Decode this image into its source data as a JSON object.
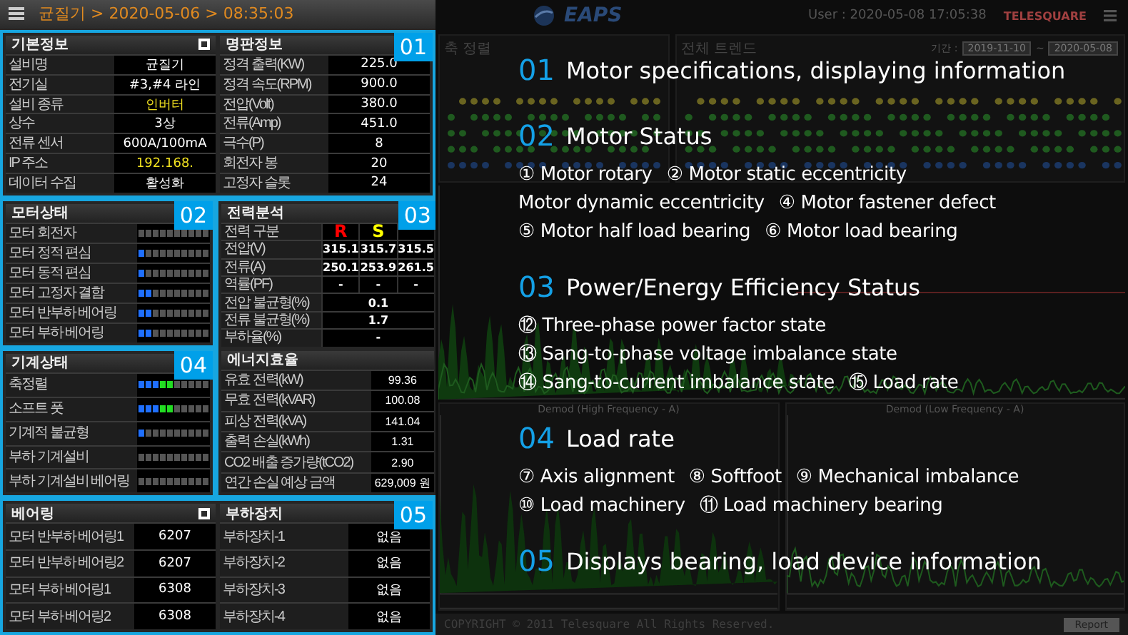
{
  "header": {
    "breadcrumb": "균질기 > 2020-05-06 > 08:35:03"
  },
  "basic_info": {
    "title": "기본정보",
    "badge": "01",
    "rows": [
      {
        "label": "설비명",
        "value": "균질기",
        "highlight": false
      },
      {
        "label": "전기실",
        "value": "#3,#4 라인",
        "highlight": false
      },
      {
        "label": "설비 종류",
        "value": "인버터",
        "highlight": true
      },
      {
        "label": "상수",
        "value": "3상",
        "highlight": false
      },
      {
        "label": "전류 센서",
        "value": "600A/100mA",
        "highlight": false
      },
      {
        "label": "IP 주소",
        "value": "192.168.",
        "highlight": true
      },
      {
        "label": "데이터 수집",
        "value": "활성화",
        "highlight": false
      }
    ]
  },
  "nameplate": {
    "title": "명판정보",
    "rows": [
      {
        "label": "정격 출력(KW)",
        "value": "225.0"
      },
      {
        "label": "정격 속도(RPM)",
        "value": "900.0"
      },
      {
        "label": "전압(Volt)",
        "value": "380.0"
      },
      {
        "label": "전류(Amp)",
        "value": "451.0"
      },
      {
        "label": "극수(P)",
        "value": "8"
      },
      {
        "label": "회전자 봉",
        "value": "20"
      },
      {
        "label": "고정자 슬롯",
        "value": "24"
      }
    ]
  },
  "motor_status": {
    "title": "모터상태",
    "badge": "02",
    "rows": [
      {
        "label": "모터 회전자",
        "level": 0
      },
      {
        "label": "모터 정적 편심",
        "level": 0.1
      },
      {
        "label": "모터 동적 편심",
        "level": 0.1
      },
      {
        "label": "모터 고정자 결함",
        "level": 0.2
      },
      {
        "label": "모터 반부하 베어링",
        "level": 0.2
      },
      {
        "label": "모터 부하 베어링",
        "level": 0.2
      }
    ]
  },
  "power_analysis": {
    "title": "전력분석",
    "badge": "03",
    "phase_label": "전력 구분",
    "phases": [
      {
        "name": "R",
        "color": "#ff0000"
      },
      {
        "name": "S",
        "color": "#ffff00"
      }
    ],
    "rows": [
      {
        "label": "전압(V)",
        "values": [
          "315.1",
          "315.7",
          "315.5"
        ]
      },
      {
        "label": "전류(A)",
        "values": [
          "250.1",
          "253.9",
          "261.5"
        ]
      },
      {
        "label": "역률(PF)",
        "values": [
          "-",
          "-",
          "-"
        ]
      },
      {
        "label": "전압 불균형(%)",
        "values": [
          "0.1"
        ]
      },
      {
        "label": "전류 불균형(%)",
        "values": [
          "1.7"
        ]
      },
      {
        "label": "부하율(%)",
        "values": [
          "-"
        ]
      }
    ]
  },
  "machine_status": {
    "title": "기계상태",
    "badge": "04",
    "rows": [
      {
        "label": "축정렬",
        "level": 0.5
      },
      {
        "label": "소프트 풋",
        "level": 0.5
      },
      {
        "label": "기계적 불균형",
        "level": 0.1
      },
      {
        "label": "부하 기계설비",
        "level": 0
      },
      {
        "label": "부하 기계설비 베어링",
        "level": 0
      }
    ]
  },
  "energy": {
    "title": "에너지효율",
    "rows": [
      {
        "label": "유효 전력(kW)",
        "value": "99.36"
      },
      {
        "label": "무효 전력(kVAR)",
        "value": "100.08"
      },
      {
        "label": "피상 전력(kVA)",
        "value": "141.04"
      },
      {
        "label": "출력 손실(kWh)",
        "value": "1.31"
      },
      {
        "label": "CO2 배출 증가량(tCO2)",
        "value": "2.90"
      },
      {
        "label": "연간 손실 예상 금액",
        "value": "629,009 원"
      }
    ]
  },
  "bearing": {
    "title": "베어링",
    "badge": "05",
    "rows": [
      {
        "label": "모터 반부하 베어링1",
        "value": "6207"
      },
      {
        "label": "모터 반부하 베어링2",
        "value": "6207"
      },
      {
        "label": "모터 부하 베어링1",
        "value": "6308"
      },
      {
        "label": "모터 부하 베어링2",
        "value": "6308"
      }
    ]
  },
  "load_device": {
    "title": "부하장치",
    "rows": [
      {
        "label": "부하장치-1",
        "value": "없음"
      },
      {
        "label": "부하장치-2",
        "value": "없음"
      },
      {
        "label": "부하장치-3",
        "value": "없음"
      },
      {
        "label": "부하장치-4",
        "value": "없음"
      }
    ]
  },
  "dashboard": {
    "logo": "EAPS",
    "user": "User : 2020-05-08 17:05:38",
    "brand": "TELESQUARE",
    "align_title": "축 정렬",
    "trend_title": "전체 트렌드",
    "period_label": "기간 :",
    "period_from": "2019-11-10",
    "period_sep": "~",
    "period_to": "2020-05-08",
    "demod_high": "Demod (High Frequency - A)",
    "demod_low": "Demod (Low Frequency - A)",
    "copyright": "COPYRIGHT © 2011 Telesquare All Rights Reserved.",
    "report": "Report"
  },
  "notes": [
    {
      "number": "01",
      "title": "Motor specifications, displaying information"
    },
    {
      "number": "02",
      "title": "Motor Status",
      "lines": [
        [
          "① Motor rotary",
          "② Motor static eccentricity"
        ],
        [
          "Motor dynamic eccentricity",
          "④ Motor fastener defect"
        ],
        [
          "⑤ Motor half load bearing",
          "⑥ Motor load bearing"
        ]
      ]
    },
    {
      "number": "03",
      "title": "Power/Energy Efficiency Status",
      "lines": [
        [
          "⑫ Three-phase power factor state"
        ],
        [
          "⑬ Sang-to-phase voltage imbalance state"
        ],
        [
          "⑭ Sang-to-current imbalance state",
          "⑮ Load rate"
        ]
      ]
    },
    {
      "number": "04",
      "title": "Load rate",
      "lines": [
        [
          "⑦ Axis alignment",
          "⑧ Softfoot",
          "⑨ Mechanical imbalance"
        ],
        [
          "⑩ Load machinery",
          "⑪ Load machinery bearing"
        ]
      ]
    },
    {
      "number": "05",
      "title": "Displays bearing, load device information"
    }
  ]
}
